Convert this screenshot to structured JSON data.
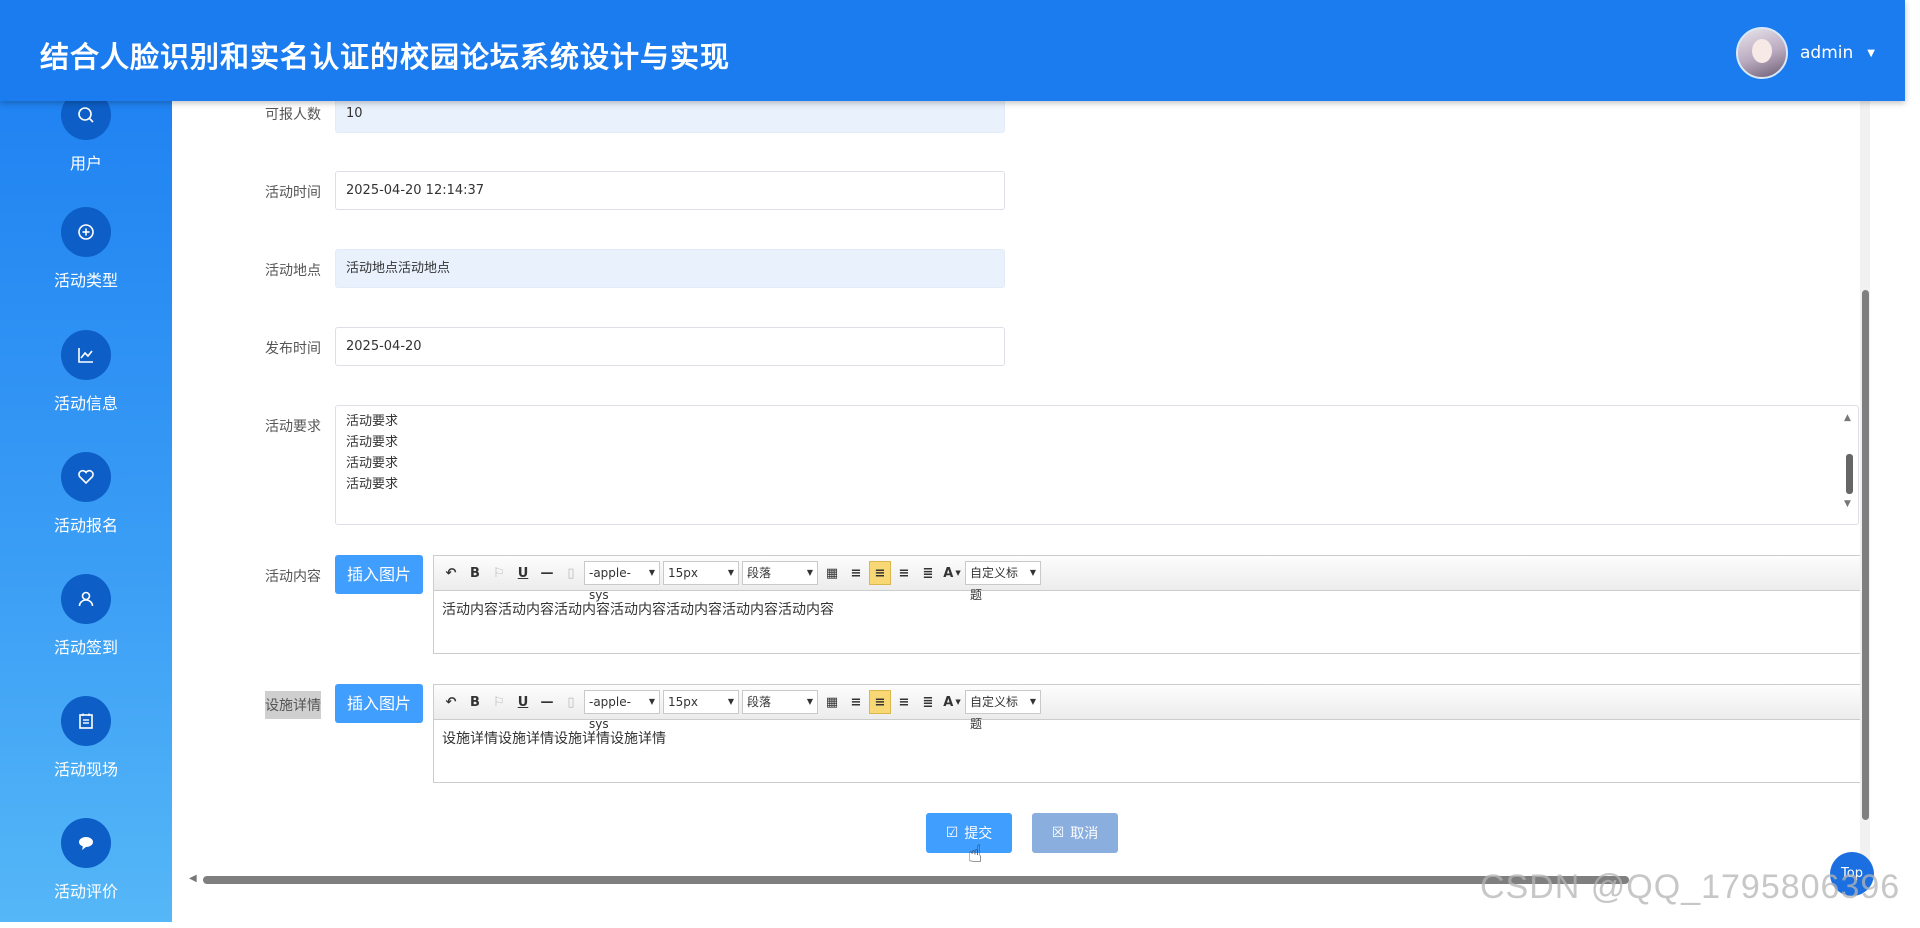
{
  "header": {
    "title": "结合人脸识别和实名认证的校园论坛系统设计与实现",
    "username": "admin"
  },
  "sidebar": {
    "items": [
      {
        "label": "用户",
        "icon": "search-icon"
      },
      {
        "label": "活动类型",
        "icon": "plus-circle-icon"
      },
      {
        "label": "活动信息",
        "icon": "line-chart-icon"
      },
      {
        "label": "活动报名",
        "icon": "heart-plus-icon"
      },
      {
        "label": "活动签到",
        "icon": "user-icon"
      },
      {
        "label": "活动现场",
        "icon": "calendar-icon"
      },
      {
        "label": "活动评价",
        "icon": "chat-icon"
      }
    ]
  },
  "form": {
    "capacity": {
      "label": "可报人数",
      "value": "10"
    },
    "time": {
      "label": "活动时间",
      "value": "2025-04-20 12:14:37"
    },
    "location": {
      "label": "活动地点",
      "value": "活动地点活动地点"
    },
    "publish": {
      "label": "发布时间",
      "value": "2025-04-20"
    },
    "requirements": {
      "label": "活动要求",
      "lines": [
        "活动要求",
        "活动要求",
        "活动要求",
        "活动要求"
      ]
    },
    "content": {
      "label": "活动内容",
      "insert_label": "插入图片",
      "body": "活动内容活动内容活动内容活动内容活动内容活动内容活动内容"
    },
    "facilities": {
      "label": "设施详情",
      "insert_label": "插入图片",
      "body": "设施详情设施详情设施详情设施详情"
    }
  },
  "toolbar": {
    "font_family": "-apple-sys",
    "font_size": "15px",
    "paragraph": "段落",
    "custom_title": "自定义标题",
    "font_color_glyph": "A"
  },
  "actions": {
    "submit_label": "提交",
    "cancel_label": "取消",
    "top_label": "Top"
  },
  "watermark": "CSDN @QQ_1795806396",
  "colors": {
    "header": "#1b7cf0",
    "sidebar_top": "#1a7df1",
    "sidebar_bottom": "#55b7f7",
    "primary_button": "#409eff",
    "cancel_button": "#8aaede"
  }
}
